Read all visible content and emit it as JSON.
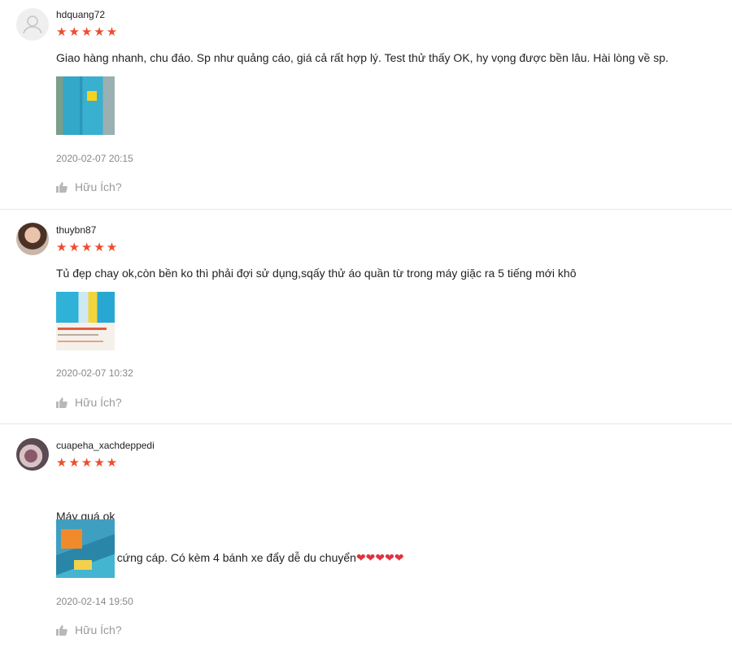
{
  "reviews": [
    {
      "username": "hdquang72",
      "stars": "★★★★★",
      "content": "Giao hàng nhanh, chu đáo. Sp như quảng cáo, giá cả rất hợp lý. Test thử thấy OK, hy vọng được bền lâu. Hài lòng về sp.",
      "timestamp": "2020-02-07 20:15",
      "helpful": "Hữu Ích?"
    },
    {
      "username": "thuybn87",
      "stars": "★★★★★",
      "content": "Tủ đẹp chay ok,còn bền ko thì phải đợi sử dụng,sqấy thử áo quần từ trong máy giặc ra 5 tiếng mới khô",
      "timestamp": "2020-02-07 10:32",
      "helpful": "Hữu Ích?"
    },
    {
      "username": "cuapeha_xachdeppedi",
      "stars": "★★★★★",
      "content_line1": "Máy quá ok",
      "content_line2": "Chắc chắn, cứng cáp. Có kèm 4 bánh xe đẩy dễ du chuyển",
      "hearts": "❤❤❤❤❤",
      "timestamp": "2020-02-14 19:50",
      "helpful": "Hữu Ích?"
    }
  ],
  "colors": {
    "star": "#ee4d2d",
    "heart": "#e0323f",
    "muted": "#888888"
  }
}
